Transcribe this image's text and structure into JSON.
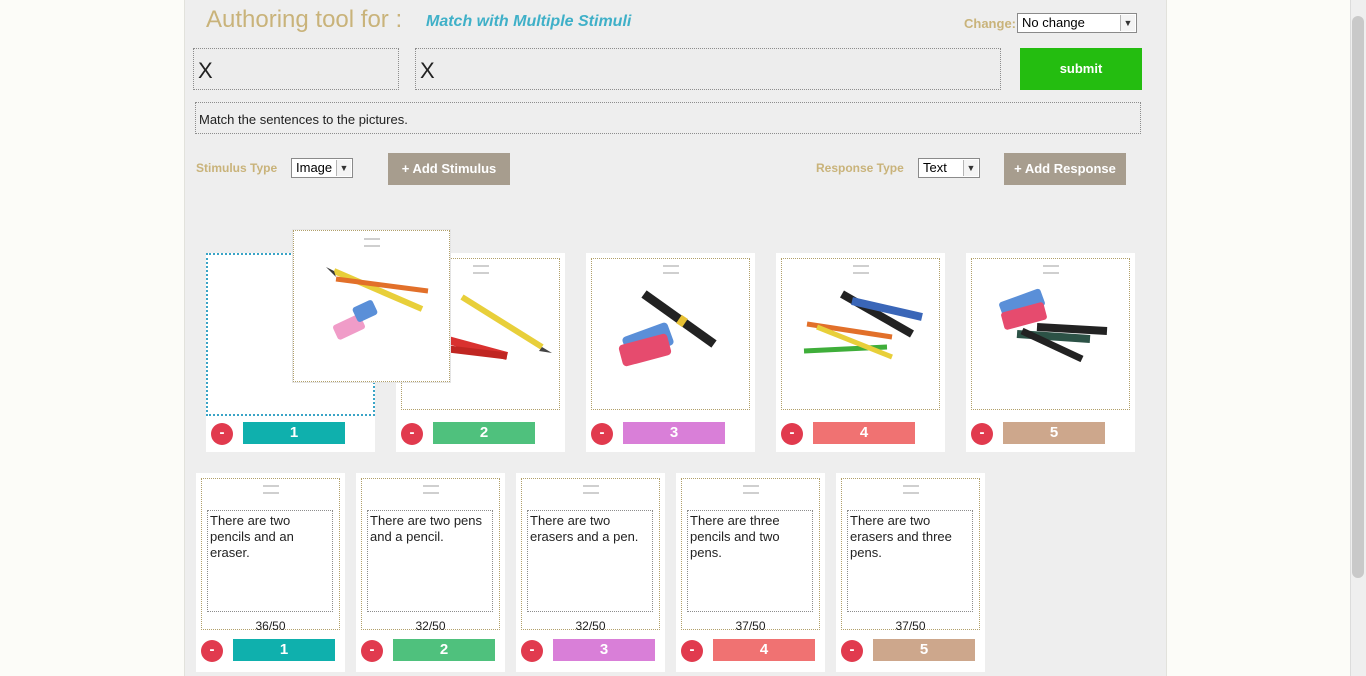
{
  "header": {
    "title": "Authoring tool for :",
    "subtitle": "Match with Multiple Stimuli",
    "change_label": "Change:",
    "change_value": "No change"
  },
  "fields": {
    "field1": "X",
    "field2": "X"
  },
  "submit_label": "submit",
  "instruction": "Match the sentences to the pictures.",
  "stimulus": {
    "type_label": "Stimulus Type",
    "type_value": "Image",
    "add_label": "+ Add Stimulus"
  },
  "response": {
    "type_label": "Response Type",
    "type_value": "Text",
    "add_label": "+ Add Response"
  },
  "colors": {
    "accent": "#24bd10",
    "c1": "#0fb0ad",
    "c2": "#4fc17d",
    "c3": "#d97fd8",
    "c4": "#f07272",
    "c5": "#cda78c"
  },
  "stimuli": [
    {
      "num": "1",
      "image": "pencils-and-eraser-image"
    },
    {
      "num": "2",
      "image": "pens-and-pencil-image"
    },
    {
      "num": "3",
      "image": "erasers-and-pen-image"
    },
    {
      "num": "4",
      "image": "pencils-and-pens-image"
    },
    {
      "num": "5",
      "image": "erasers-and-pens-image"
    }
  ],
  "responses": [
    {
      "num": "1",
      "text": "There are two pencils and an eraser.",
      "count": "36/50"
    },
    {
      "num": "2",
      "text": "There are two pens and a pencil.",
      "count": "32/50"
    },
    {
      "num": "3",
      "text": "There are two erasers and a pen.",
      "count": "32/50"
    },
    {
      "num": "4",
      "text": "There are three pencils and two pens.",
      "count": "37/50"
    },
    {
      "num": "5",
      "text": "There are two erasers and three pens.",
      "count": "37/50"
    }
  ],
  "remove_label": "-"
}
